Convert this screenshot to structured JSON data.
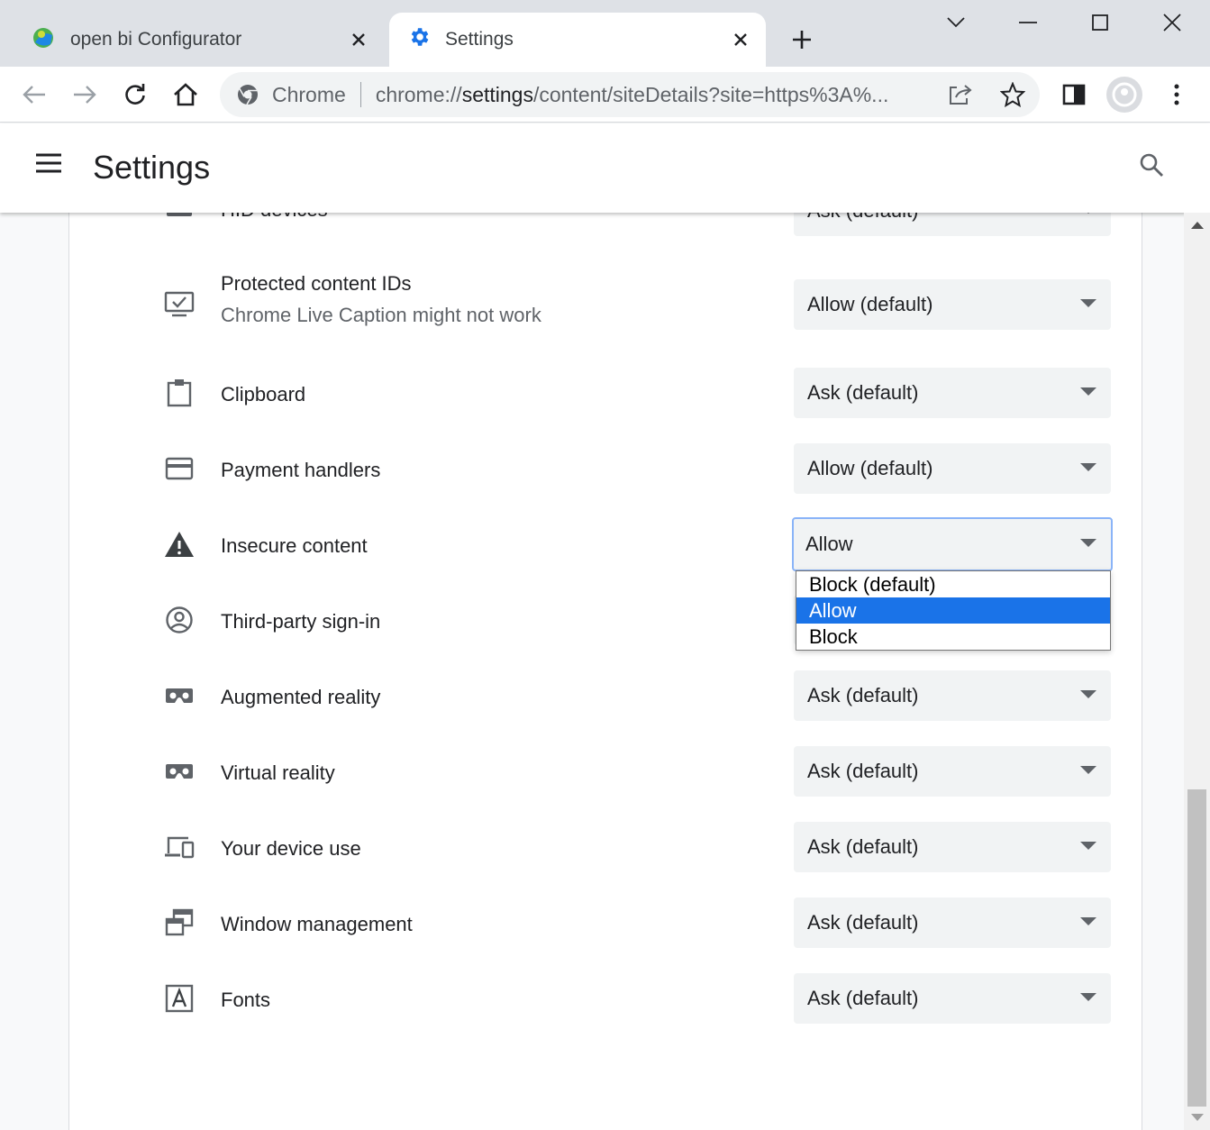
{
  "browser": {
    "tabs": [
      {
        "title": "open bi Configurator",
        "icon": "open-bi-logo-icon",
        "active": false
      },
      {
        "title": "Settings",
        "icon": "gear-icon",
        "active": true
      }
    ],
    "omnibox": {
      "site_label": "Chrome",
      "url_scheme": "chrome://",
      "url_host": "settings",
      "url_path": "/content/siteDetails?site=https%3A%..."
    }
  },
  "header": {
    "title": "Settings"
  },
  "permissions": [
    {
      "label": "HID devices",
      "value": "Ask (default)",
      "icon": "hid-device-icon"
    },
    {
      "label": "Protected content IDs",
      "sublabel": "Chrome Live Caption might not work",
      "value": "Allow (default)",
      "icon": "protected-content-icon"
    },
    {
      "label": "Clipboard",
      "value": "Ask (default)",
      "icon": "clipboard-icon"
    },
    {
      "label": "Payment handlers",
      "value": "Allow (default)",
      "icon": "credit-card-icon"
    },
    {
      "label": "Insecure content",
      "value": "Allow",
      "icon": "warning-icon"
    },
    {
      "label": "Third-party sign-in",
      "value": "",
      "icon": "account-circle-icon"
    },
    {
      "label": "Augmented reality",
      "value": "Ask (default)",
      "icon": "vr-headset-icon"
    },
    {
      "label": "Virtual reality",
      "value": "Ask (default)",
      "icon": "vr-headset-icon"
    },
    {
      "label": "Your device use",
      "value": "Ask (default)",
      "icon": "devices-icon"
    },
    {
      "label": "Window management",
      "value": "Ask (default)",
      "icon": "window-management-icon"
    },
    {
      "label": "Fonts",
      "value": "Ask (default)",
      "icon": "font-icon"
    }
  ],
  "dropdown": {
    "options": [
      "Block (default)",
      "Allow",
      "Block"
    ],
    "selected": "Allow"
  },
  "colors": {
    "accent": "#1a73e8",
    "focus_ring": "#8ab4f8"
  }
}
